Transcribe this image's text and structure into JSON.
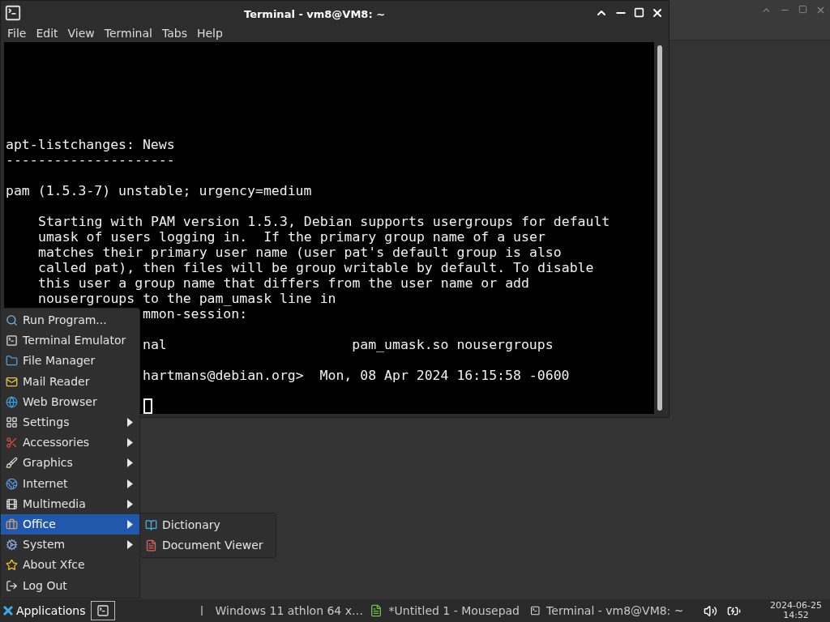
{
  "window": {
    "title": "Terminal - vm8@VM8: ~",
    "menu": [
      "File",
      "Edit",
      "View",
      "Terminal",
      "Tabs",
      "Help"
    ]
  },
  "terminal": {
    "lines": [
      {
        "kind": "text",
        "text": "apt-listchanges: News"
      },
      {
        "kind": "text",
        "text": "---------------------"
      },
      {
        "kind": "blank"
      },
      {
        "kind": "text",
        "text": "pam (1.5.3-7) unstable; urgency=medium"
      },
      {
        "kind": "blank"
      },
      {
        "kind": "indented",
        "text": "Starting with PAM version 1.5.3, Debian supports usergroups for default"
      },
      {
        "kind": "indented",
        "text": "umask of users logging in.  If the primary group name of a user"
      },
      {
        "kind": "indented",
        "text": "matches their primary user name (user pat's default group is also"
      },
      {
        "kind": "indented",
        "text": "called pat), then files will be group writable by default. To disable"
      },
      {
        "kind": "indented",
        "text": "this user a group name that differs from the user name or add"
      },
      {
        "kind": "indented",
        "text": "nousergroups to the pam_umask line in"
      },
      {
        "kind": "clipped",
        "text": "mmon-session:"
      },
      {
        "kind": "blank"
      },
      {
        "kind": "clipped",
        "text": "nal                       pam_umask.so nousergroups"
      },
      {
        "kind": "blank"
      },
      {
        "kind": "clipped",
        "text": "hartmans@debian.org>  Mon, 08 Apr 2024 16:15:58 -0600"
      },
      {
        "kind": "blank"
      },
      {
        "kind": "cursor"
      }
    ]
  },
  "app_menu": {
    "items": [
      {
        "label": "Run Program...",
        "submenu": false,
        "selected": false
      },
      {
        "label": "Terminal Emulator",
        "submenu": false,
        "selected": false
      },
      {
        "label": "File Manager",
        "submenu": false,
        "selected": false
      },
      {
        "label": "Mail Reader",
        "submenu": false,
        "selected": false
      },
      {
        "label": "Web Browser",
        "submenu": false,
        "selected": false
      },
      {
        "label": "Settings",
        "submenu": true,
        "selected": false
      },
      {
        "label": "Accessories",
        "submenu": true,
        "selected": false
      },
      {
        "label": "Graphics",
        "submenu": true,
        "selected": false
      },
      {
        "label": "Internet",
        "submenu": true,
        "selected": false
      },
      {
        "label": "Multimedia",
        "submenu": true,
        "selected": false
      },
      {
        "label": "Office",
        "submenu": true,
        "selected": true
      },
      {
        "label": "System",
        "submenu": true,
        "selected": false
      },
      {
        "label": "About Xfce",
        "submenu": false,
        "selected": false
      },
      {
        "label": "Log Out",
        "submenu": false,
        "selected": false
      }
    ]
  },
  "submenu": {
    "items": [
      {
        "label": "Dictionary"
      },
      {
        "label": "Document Viewer"
      }
    ]
  },
  "taskbar": {
    "menu_button": "Applications",
    "tasks": [
      {
        "label": "Windows 11 athlon 64 x…"
      },
      {
        "label": "*Untitled 1 - Mousepad"
      },
      {
        "label": "Terminal - vm8@VM8: ~"
      }
    ],
    "clock": {
      "date": "2024-06-25",
      "time": "14:52"
    }
  }
}
